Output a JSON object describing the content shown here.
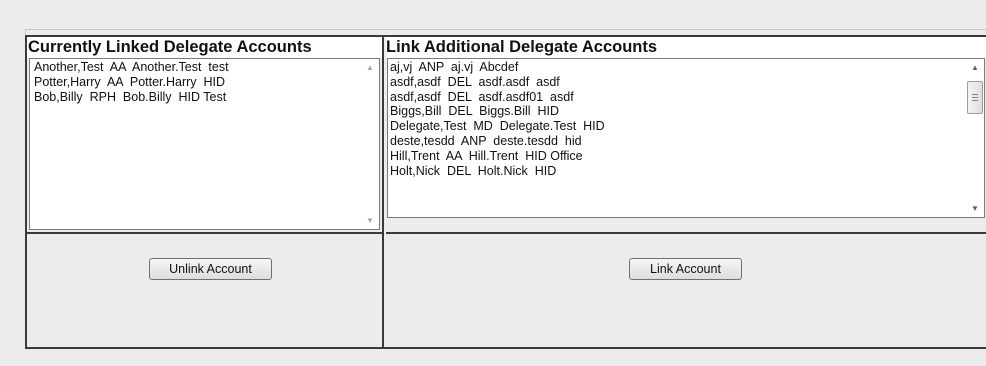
{
  "linked": {
    "header": "Currently Linked Delegate Accounts",
    "items": [
      "Another,Test  AA  Another.Test  test",
      "Potter,Harry  AA  Potter.Harry  HID",
      "Bob,Billy  RPH  Bob.Billy  HID Test"
    ],
    "button_label": "Unlink Account"
  },
  "available": {
    "header": "Link Additional Delegate Accounts",
    "items": [
      "aj,vj  ANP  aj.vj  Abcdef",
      "asdf,asdf  DEL  asdf.asdf  asdf",
      "asdf,asdf  DEL  asdf.asdf01  asdf",
      "Biggs,Bill  DEL  Biggs.Bill  HID",
      "Delegate,Test  MD  Delegate.Test  HID",
      "deste,tesdd  ANP  deste.tesdd  hid",
      "Hill,Trent  AA  Hill.Trent  HID Office",
      "Holt,Nick  DEL  Holt.Nick  HID"
    ],
    "button_label": "Link Account"
  },
  "icons": {
    "scroll_up": "▲",
    "scroll_down": "▼"
  },
  "colors": {
    "border": "#3a3a3a",
    "panel": "#ececec",
    "listbox": "#ffffff"
  }
}
